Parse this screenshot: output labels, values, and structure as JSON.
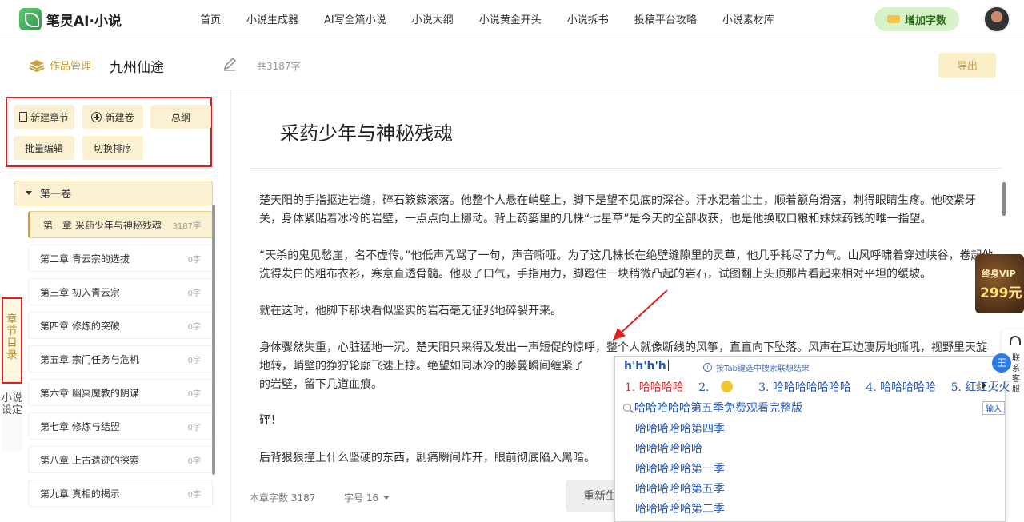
{
  "app": {
    "name": "笔灵AI·小说"
  },
  "nav": {
    "items": [
      "首页",
      "小说生成器",
      "AI写全篇小说",
      "小说大纲",
      "小说黄金开头",
      "小说拆书",
      "投稿平台攻略",
      "小说素材库"
    ],
    "add_words": "增加字数"
  },
  "header": {
    "works": "作品管理",
    "book_title": "九州仙途",
    "word_count": "共3187字",
    "export": "导出"
  },
  "left_tabs": {
    "chapters": "章节目录",
    "settings": "小说设定"
  },
  "toolbar": {
    "new_chapter": "新建章节",
    "new_volume": "新建卷",
    "outline": "总纲",
    "batch_edit": "批量编辑",
    "sort": "切换排序"
  },
  "volume": {
    "name": "第一卷"
  },
  "chapters": [
    {
      "title": "第一章 采药少年与神秘残魂",
      "count": "3187字"
    },
    {
      "title": "第二章 青云宗的选拔",
      "count": "0字"
    },
    {
      "title": "第三章 初入青云宗",
      "count": "0字"
    },
    {
      "title": "第四章 修炼的突破",
      "count": "0字"
    },
    {
      "title": "第五章 宗门任务与危机",
      "count": "0字"
    },
    {
      "title": "第六章 幽冥魔教的阴谋",
      "count": "0字"
    },
    {
      "title": "第七章 修炼与结盟",
      "count": "0字"
    },
    {
      "title": "第八章 上古遗迹的探索",
      "count": "0字"
    },
    {
      "title": "第九章 真相的揭示",
      "count": "0字"
    }
  ],
  "editor": {
    "title": "采药少年与神秘残魂",
    "paragraphs": [
      "楚天阳的手指抠进岩缝，碎石簌簌滚落。他整个人悬在峭壁上，脚下是望不见底的深谷。汗水混着尘土，顺着额角滑落，刺得眼睛生疼。他咬紧牙关，身体紧贴着冰冷的岩壁，一点点向上挪动。背上药篓里的几株“七星草”是今天的全部收获，也是他换取口粮和妹妹药钱的唯一指望。",
      "“天杀的鬼见愁崖，名不虚传。”他低声咒骂了一句，声音嘶哑。为了这几株长在绝壁缝隙里的灵草，他几乎耗尽了力气。山风呼啸着穿过峡谷，卷起他洗得发白的粗布衣衫，寒意直透骨髓。他吸了口气，手指用力，脚蹬住一块稍微凸起的岩石，试图翻上头顶那片看起来相对平坦的缓坡。",
      "就在这时，他脚下那块看似坚实的岩石毫无征兆地碎裂开来。",
      "身体骤然失重，心脏猛地一沉。楚天阳只来得及发出一声短促的惊呼，整个人就像断线的风筝，直直向下坠落。风声在耳边凄厉地嘶吼，视野里天旋地转，峭壁的狰狞轮廓飞速上掠。绝望如同冰冷的藤蔓瞬间缠紧了",
      "的岩壁，留下几道血痕。",
      "砰！",
      "后背狠狠撞上什么坚硬的东西，剧痛瞬间炸开，眼前彻底陷入黑暗。"
    ],
    "footer_count": "本章字数 3187",
    "font_size": "字号 16",
    "regen": "重新生"
  },
  "ime": {
    "input": "h'h'h'h",
    "tip": "按Tab键选中搜索联想结果",
    "candidates": [
      "1. 哈哈哈哈",
      "2.",
      "3. 哈哈哈哈哈哈哈",
      "4. 哈哈哈哈哈",
      "5. 红红火火"
    ],
    "search": "哈哈哈哈哈第五季免费观看完整版",
    "enter": "输入",
    "suggestions": [
      "哈哈哈哈哈第四季",
      "哈哈哈哈哈哈",
      "哈哈哈哈哈第一季",
      "哈哈哈哈哈第五季",
      "哈哈哈哈哈第二季"
    ]
  },
  "floaters": {
    "vip_top": "终身VIP",
    "vip_price": "299元",
    "service": "联系客服",
    "service_badge": "王"
  },
  "colors": {
    "accent": "#c9a13a",
    "accent_bg": "#fbf1d2",
    "annotation": "#e02020",
    "ime_blue": "#2458b8"
  }
}
